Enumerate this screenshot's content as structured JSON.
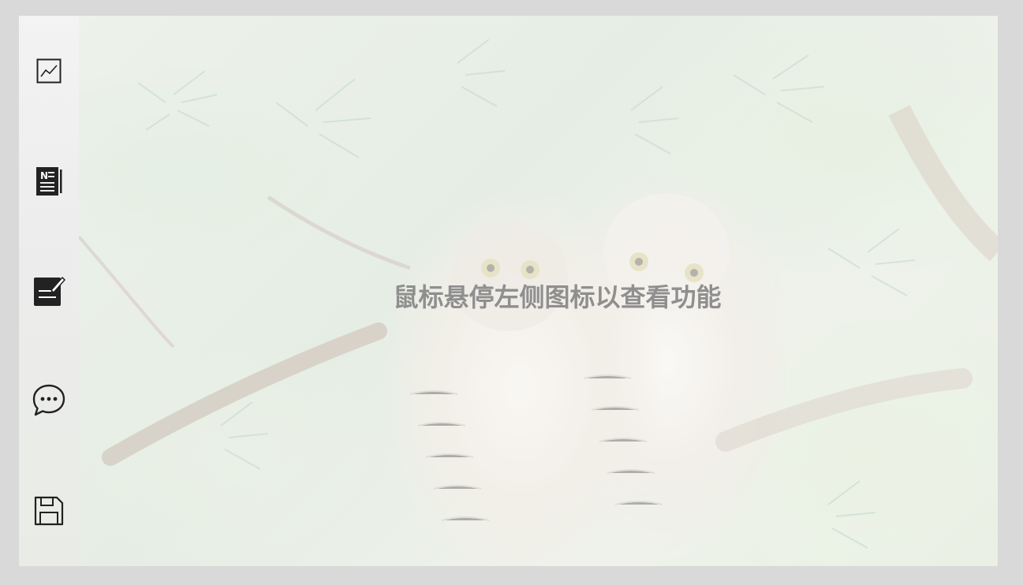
{
  "sidebar": {
    "items": [
      {
        "icon": "line-chart-icon"
      },
      {
        "icon": "notebook-icon"
      },
      {
        "icon": "edit-note-icon"
      },
      {
        "icon": "chat-bubble-icon"
      },
      {
        "icon": "save-floppy-icon"
      }
    ]
  },
  "main": {
    "hint_text": "鼠标悬停左侧图标以查看功能",
    "background_image": "owls-in-pine-tree"
  },
  "colors": {
    "page_background": "#d9d9d9",
    "sidebar_background": "#f0f0f0",
    "hint_text": "#8f8f8f",
    "icon_dark": "#222222"
  }
}
